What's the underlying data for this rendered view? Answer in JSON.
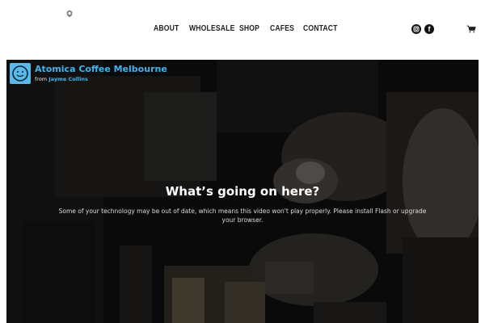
{
  "nav": {
    "items": [
      {
        "label": "ABOUT"
      },
      {
        "label": "WHOLESALE"
      },
      {
        "label": "SHOP"
      },
      {
        "label": "CAFES"
      },
      {
        "label": "CONTACT"
      }
    ]
  },
  "social": {
    "icons": [
      "instagram-icon",
      "facebook-icon"
    ],
    "facebook_glyph": "f"
  },
  "cart": {
    "icon": "cart-icon"
  },
  "video": {
    "title": "Atomica Coffee Melbourne",
    "from_prefix": "from",
    "author": "Jayme Collins",
    "message_title": "What’s going on here?",
    "message_body": "Some of your technology may be out of date, which means this video won't play properly. Please install Flash or upgrade your browser."
  },
  "colors": {
    "link_blue": "#41b4ec",
    "badge_blue": "#5bb8e8",
    "nav_text": "#222222"
  }
}
